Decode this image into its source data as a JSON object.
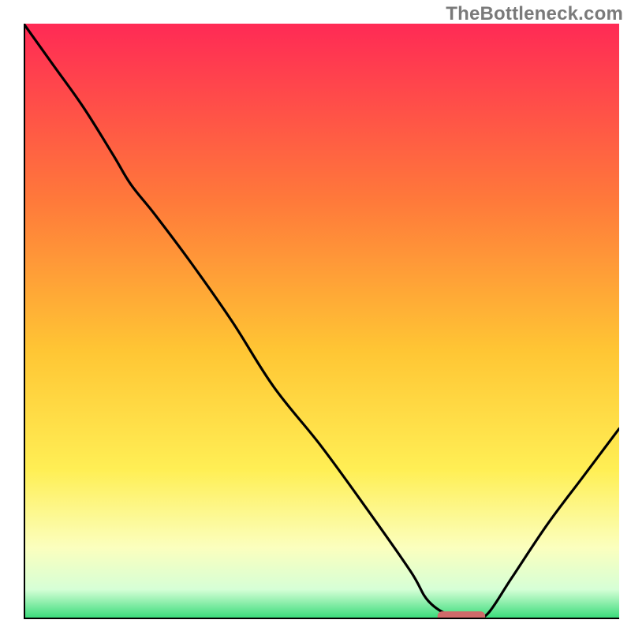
{
  "watermark": "TheBottleneck.com",
  "colors": {
    "gradient_top": "#ff2a55",
    "gradient_upper_mid": "#ff8a2e",
    "gradient_mid": "#ffd22e",
    "gradient_lower_mid": "#fff799",
    "gradient_lower": "#f6ffe1",
    "gradient_bottom": "#33da77",
    "curve": "#000000",
    "marker": "#cf6a6a",
    "axes": "#000000"
  },
  "chart_data": {
    "type": "line",
    "title": "",
    "xlabel": "",
    "ylabel": "",
    "xlim": [
      0,
      100
    ],
    "ylim": [
      0,
      100
    ],
    "series": [
      {
        "name": "bottleneck-curve",
        "x": [
          0,
          5,
          10,
          15,
          18,
          22,
          28,
          35,
          42,
          50,
          58,
          65,
          68,
          72,
          76,
          78,
          82,
          88,
          94,
          100
        ],
        "values": [
          100,
          93,
          86,
          78,
          73,
          68,
          60,
          50,
          39,
          29,
          18,
          8,
          3,
          0.5,
          0.5,
          1,
          7,
          16,
          24,
          32
        ]
      }
    ],
    "annotations": [
      {
        "name": "highlight-marker",
        "shape": "rounded-rect",
        "x_center": 73.5,
        "y_center": 0.4,
        "width": 8,
        "height": 1.8,
        "color": "#cf6a6a"
      }
    ],
    "background": {
      "type": "vertical-gradient",
      "stops": [
        {
          "offset": 0.0,
          "color": "#ff2a55"
        },
        {
          "offset": 0.3,
          "color": "#ff7a3a"
        },
        {
          "offset": 0.55,
          "color": "#ffc634"
        },
        {
          "offset": 0.75,
          "color": "#ffef55"
        },
        {
          "offset": 0.88,
          "color": "#fbffbe"
        },
        {
          "offset": 0.95,
          "color": "#d6ffd6"
        },
        {
          "offset": 1.0,
          "color": "#33da77"
        }
      ]
    },
    "grid": false,
    "legend": false
  }
}
